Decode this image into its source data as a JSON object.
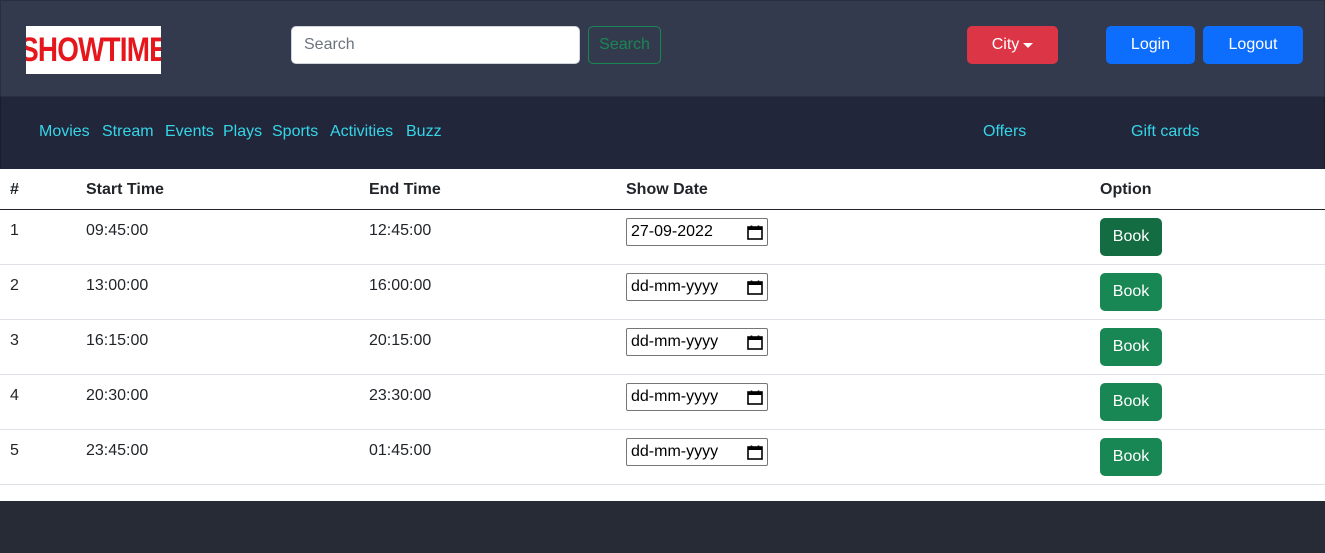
{
  "header": {
    "logo_text": "SHOWTIME",
    "search_placeholder": "Search",
    "search_button": "Search",
    "city_button": "City",
    "login_button": "Login",
    "logout_button": "Logout"
  },
  "nav": {
    "links": [
      "Movies",
      "Stream",
      "Events",
      "Plays",
      "Sports",
      "Activities",
      "Buzz"
    ],
    "offers": "Offers",
    "gift_cards": "Gift cards"
  },
  "table": {
    "headers": [
      "#",
      "Start Time",
      "End Time",
      "Show Date",
      "Option"
    ],
    "rows": [
      {
        "num": "1",
        "start": "09:45:00",
        "end": "12:45:00",
        "date": "27-09-2022",
        "option": "Book"
      },
      {
        "num": "2",
        "start": "13:00:00",
        "end": "16:00:00",
        "date": "dd-mm-yyyy",
        "option": "Book"
      },
      {
        "num": "3",
        "start": "16:15:00",
        "end": "20:15:00",
        "date": "dd-mm-yyyy",
        "option": "Book"
      },
      {
        "num": "4",
        "start": "20:30:00",
        "end": "23:30:00",
        "date": "dd-mm-yyyy",
        "option": "Book"
      },
      {
        "num": "5",
        "start": "23:45:00",
        "end": "01:45:00",
        "date": "dd-mm-yyyy",
        "option": "Book"
      }
    ]
  },
  "colors": {
    "topbar": "#343a4e",
    "navbar": "#22263a",
    "nav_link": "#34d6e8",
    "danger": "#dc3545",
    "primary": "#0d6efd",
    "success": "#198754",
    "footer": "#272b36"
  },
  "icons": {
    "date_picker": "calendar-icon",
    "city_dropdown": "caret-down-icon"
  }
}
